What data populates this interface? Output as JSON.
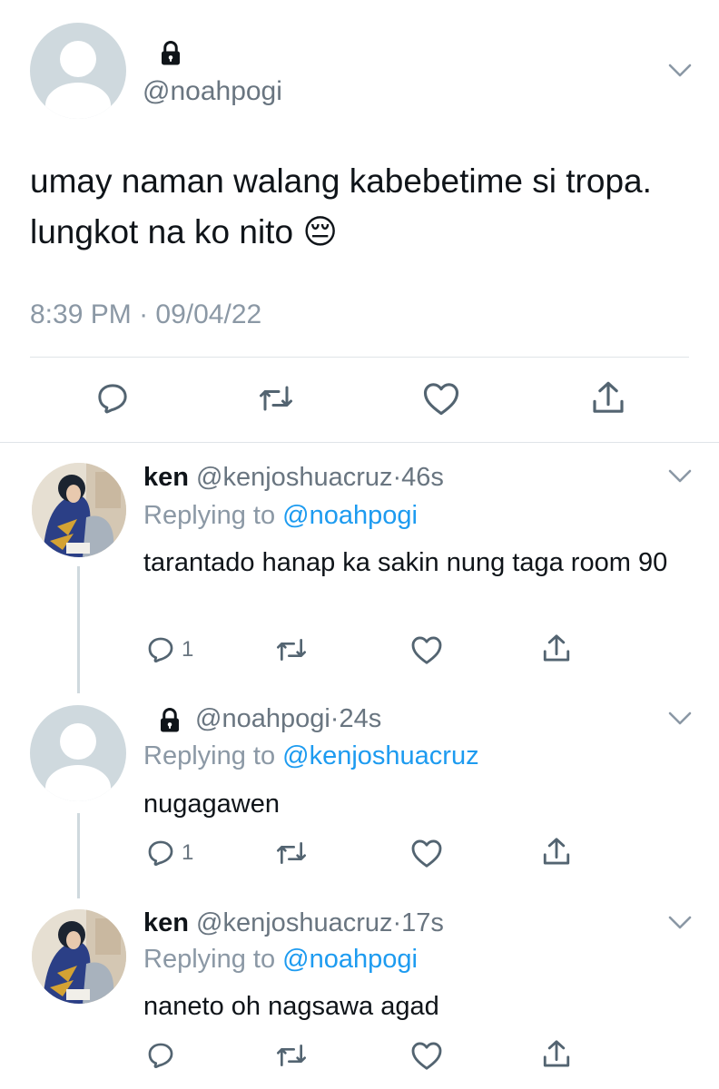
{
  "main_tweet": {
    "handle": "@noahpogi",
    "text": "umay naman walang kabebetime si tropa. lungkot na ko nito 😔",
    "time": "8:39 PM",
    "date_sep": "·",
    "date": "09/04/22",
    "icons": [
      "lock-icon",
      "chevron-down-icon",
      "reply-icon",
      "retweet-icon",
      "like-icon",
      "share-icon"
    ]
  },
  "replies": [
    {
      "name": "ken",
      "handle": "@kenjoshuacruz",
      "sep": "·",
      "age": "46s",
      "replying_prefix": "Replying to",
      "replying_to": "@noahpogi",
      "text": "tarantado hanap ka sakin nung taga room 90",
      "reply_count": "1"
    },
    {
      "name": "",
      "handle": "@noahpogi",
      "sep": "·",
      "age": "24s",
      "replying_prefix": "Replying to",
      "replying_to": "@kenjoshuacruz",
      "text": "nugagawen",
      "reply_count": "1"
    },
    {
      "name": "ken",
      "handle": "@kenjoshuacruz",
      "sep": "·",
      "age": "17s",
      "replying_prefix": "Replying to",
      "replying_to": "@noahpogi",
      "text": "naneto oh nagsawa agad",
      "reply_count": ""
    }
  ],
  "colors": {
    "accent": "#1d9bf0",
    "muted": "#8b98a5",
    "text": "#0f1419",
    "divider": "#dfe4e8"
  }
}
